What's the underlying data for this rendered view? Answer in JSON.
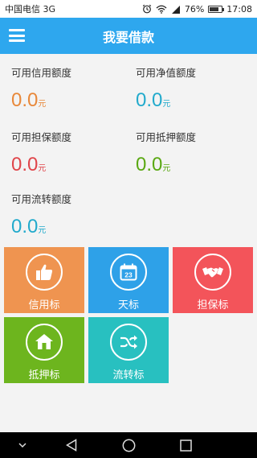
{
  "status_bar": {
    "carrier": "中国电信 3G",
    "battery_percent": "76%",
    "battery_level": 0.76,
    "time": "17:08",
    "icons": [
      "alarm-icon",
      "wifi-icon",
      "signal-icon",
      "battery-icon"
    ]
  },
  "app_bar": {
    "title": "我要借款",
    "menu_icon": "hamburger-menu-icon"
  },
  "quotas": [
    {
      "label": "可用信用额度",
      "value": "0.0",
      "unit": "元",
      "color": "#e8883a"
    },
    {
      "label": "可用净值额度",
      "value": "0.0",
      "unit": "元",
      "color": "#22aacc"
    },
    {
      "label": "可用担保额度",
      "value": "0.0",
      "unit": "元",
      "color": "#e0454a"
    },
    {
      "label": "可用抵押额度",
      "value": "0.0",
      "unit": "元",
      "color": "#5aa812"
    },
    {
      "label": "可用流转额度",
      "value": "0.0",
      "unit": "元",
      "color": "#22aacc"
    }
  ],
  "tiles": [
    {
      "label": "信用标",
      "icon": "thumbs-up-icon",
      "color": "#ef9450"
    },
    {
      "label": "天标",
      "icon": "calendar-icon",
      "calendar_day": "23",
      "color": "#2ea1e8"
    },
    {
      "label": "担保标",
      "icon": "handshake-icon",
      "color": "#f3545a"
    },
    {
      "label": "抵押标",
      "icon": "house-icon",
      "color": "#6db51e"
    },
    {
      "label": "流转标",
      "icon": "shuffle-icon",
      "color": "#28c0c0"
    }
  ],
  "nav_bar": {
    "icons": [
      "chevron-down-icon",
      "back-triangle-icon",
      "home-circle-icon",
      "recents-square-icon"
    ]
  }
}
